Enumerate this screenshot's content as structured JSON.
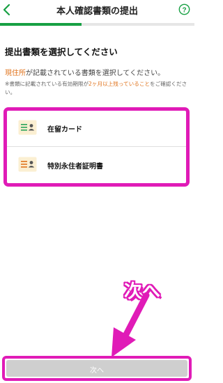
{
  "header": {
    "title": "本人確認書類の提出",
    "back_icon": "chevron-left-icon",
    "help_icon": "question-circle-icon"
  },
  "progress": {
    "fraction": 0.42
  },
  "main": {
    "section_title": "提出書類を選択してください",
    "note": {
      "highlight": "現住所",
      "rest": "が記載されている書類を選択してください。"
    },
    "subnote": {
      "prefix": "※書類に記載されている有効期限が",
      "highlight": "2ヶ月以上残っていること",
      "suffix": "をご確認ください。"
    },
    "documents": [
      {
        "label": "在留カード",
        "icon": "id-card-icon"
      },
      {
        "label": "特別永住者証明書",
        "icon": "id-card-icon"
      }
    ]
  },
  "annotation": {
    "callout": "次へ"
  },
  "footer": {
    "next_label": "次へ"
  },
  "colors": {
    "accent_green": "#17a043",
    "highlight_orange": "#e0731c",
    "annotation_magenta": "#e01bb7",
    "disabled_button": "#cfcfcf"
  }
}
